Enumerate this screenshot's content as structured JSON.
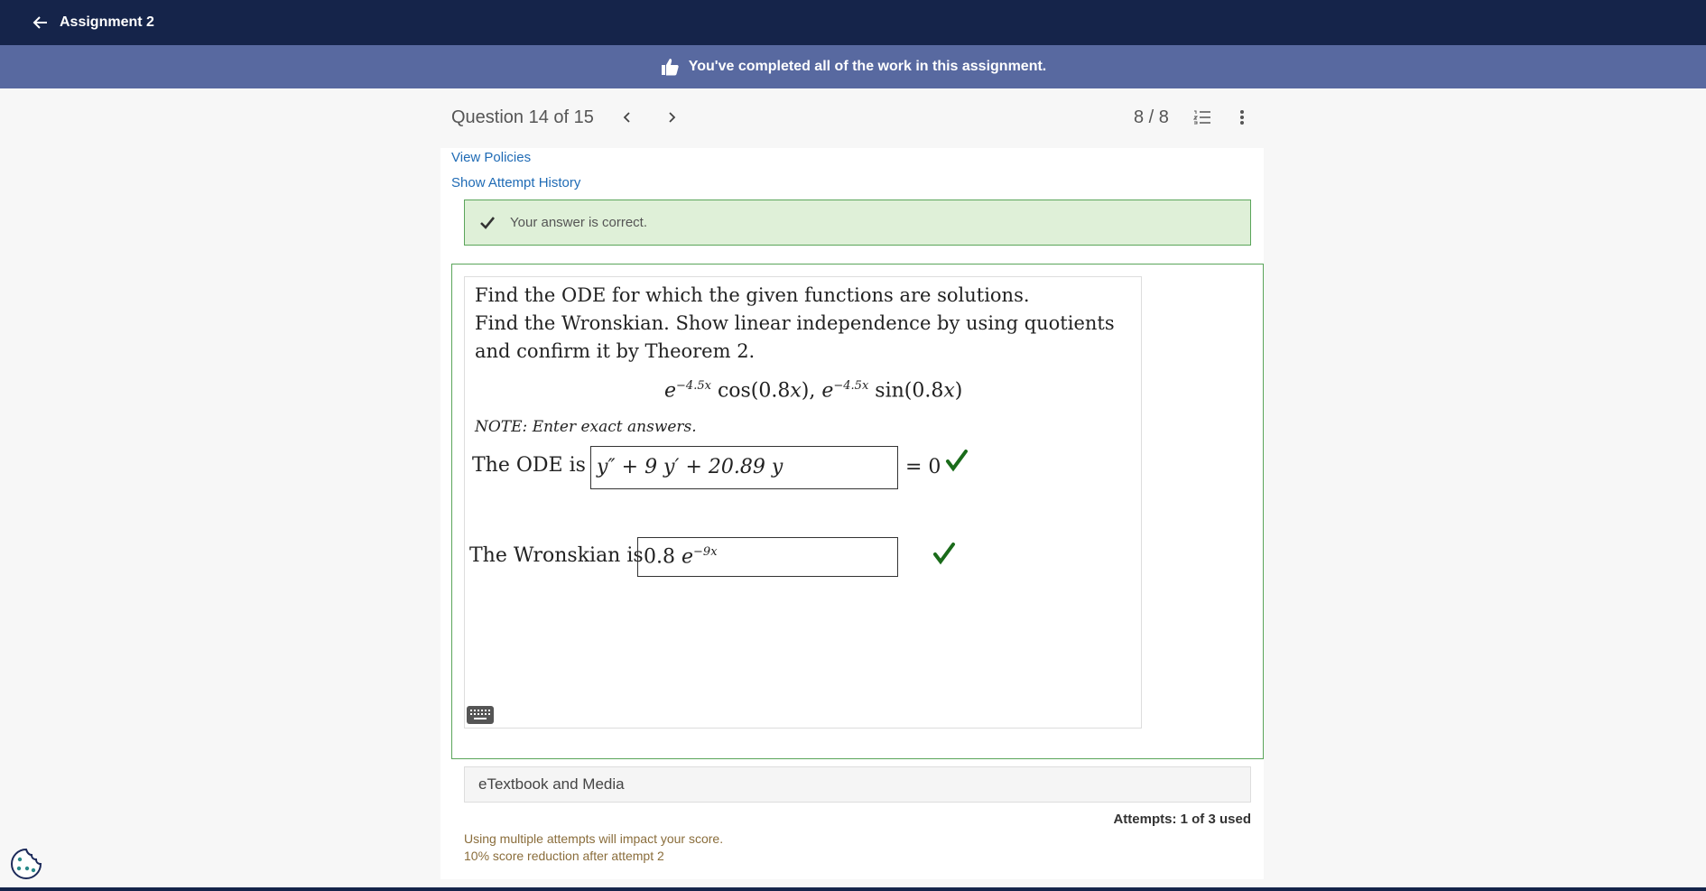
{
  "topbar": {
    "title": "Assignment 2"
  },
  "banner": {
    "text": "You've completed all of the work in this assignment."
  },
  "question_header": {
    "label": "Question 14 of 15",
    "score": "8 / 8"
  },
  "links": {
    "view_policies": "View Policies",
    "show_attempt_history": "Show Attempt History"
  },
  "feedback": {
    "message": "Your answer is correct."
  },
  "question": {
    "line1": "Find the ODE for which the given functions are solutions.",
    "line2": "Find the Wronskian. Show linear independence by using quotients",
    "line3": "and confirm it by Theorem 2.",
    "note": "NOTE: Enter exact answers.",
    "ode_label": "The ODE is",
    "ode_answer": "y″ + 9 y′ + 20.89 y",
    "ode_equals": "= 0",
    "wronskian_label": "The Wronskian is",
    "wronskian_coeff": "0.8",
    "wronskian_exp": "−9x"
  },
  "etextbook": {
    "label": "eTextbook and Media"
  },
  "attempts": {
    "text": "Attempts: 1 of 3 used"
  },
  "warnings": {
    "line1": "Using multiple attempts will impact your score.",
    "line2": "10% score reduction after attempt 2"
  },
  "colors": {
    "topbar": "#15244a",
    "banner": "#5869a0",
    "correct_bg": "#dff0d8",
    "correct_border": "#5aa55a",
    "check": "#1a6b1a",
    "link": "#1f6bb5"
  }
}
